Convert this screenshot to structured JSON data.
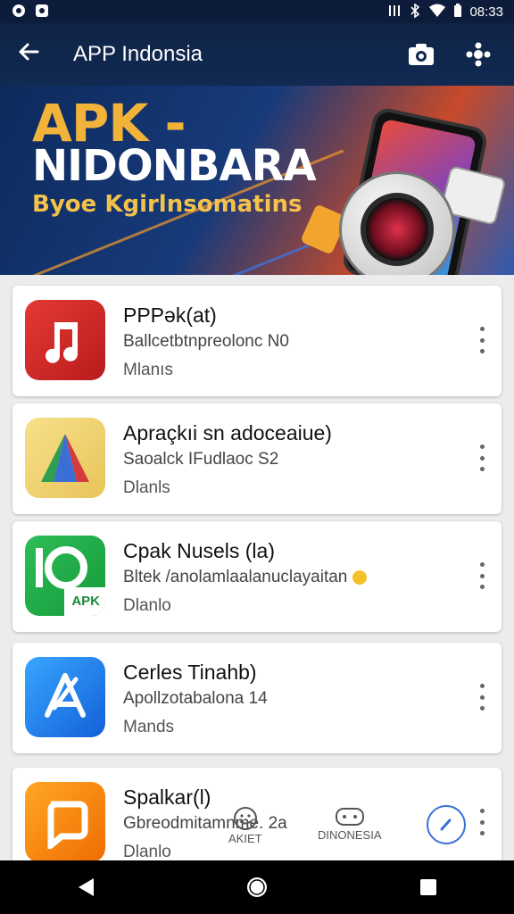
{
  "status_bar": {
    "time": "08:33",
    "left_icons": [
      "app-icon-a",
      "app-icon-b"
    ],
    "right_icons": [
      "nfc-icon",
      "bluetooth-icon",
      "wifi-icon",
      "battery-icon"
    ]
  },
  "app_bar": {
    "title": "APP Indonsia",
    "back_icon": "back-arrow-icon",
    "actions": [
      "camera-icon",
      "settings-icon"
    ]
  },
  "banner": {
    "line1": "APK -",
    "line2": "NIDONBARA",
    "line3": "Byoe Kgirlnsomatins"
  },
  "apps": [
    {
      "name": "PPPək(at)",
      "subtitle": "Ballcetbtnpreolonc N0",
      "meta": "Mlanıs",
      "icon": "music-note-icon",
      "icon_color": "#d32a2a"
    },
    {
      "name": "Apraçkıi sn adoceaiue)",
      "subtitle": "Saoalck IFudlaoc S2",
      "meta": "Dlanls",
      "icon": "triangle-a-icon",
      "icon_color": "#f3d36a"
    },
    {
      "name": "Cpak Nusels (la)",
      "subtitle": "Bltek /anolamlaalanuclayaitan",
      "meta": "Dlanlo",
      "icon": "apk-icon",
      "icon_color": "#28b24a",
      "apk_label": "APK"
    },
    {
      "name": "Cerles Tinahb)",
      "subtitle": "Apollzotabalona 14",
      "meta": "Mands",
      "icon": "app-store-icon",
      "icon_color": "#1f7fe6"
    },
    {
      "name": "Spalkar(l)",
      "subtitle": "Gbreodmitamnme. 2a",
      "meta": "Dlanlo",
      "icon": "chat-square-icon",
      "icon_color": "#f08a1c"
    }
  ],
  "bottom_tabs": [
    {
      "label": "AKIET",
      "icon": "smiley-icon"
    },
    {
      "label": "DINONESIA",
      "icon": "controller-icon"
    }
  ],
  "nav": [
    "back-triangle-icon",
    "home-circle-icon",
    "recents-square-icon"
  ]
}
